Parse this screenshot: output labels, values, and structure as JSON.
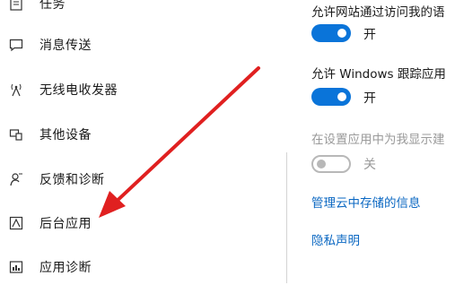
{
  "sidebar": {
    "items": [
      {
        "icon": "task-icon",
        "label": "任务"
      },
      {
        "icon": "chat-bubble-icon",
        "label": "消息传送"
      },
      {
        "icon": "radio-antenna-icon",
        "label": "无线电收发器"
      },
      {
        "icon": "devices-icon",
        "label": "其他设备"
      },
      {
        "icon": "feedback-icon",
        "label": "反馈和诊断"
      },
      {
        "icon": "background-apps-icon",
        "label": "后台应用"
      },
      {
        "icon": "app-diagnostics-icon",
        "label": "应用诊断"
      }
    ]
  },
  "settings": {
    "website_access": {
      "title": "允许网站通过访问我的语",
      "toggle_label": "开",
      "state": "on"
    },
    "windows_tracking": {
      "title": "允许 Windows 跟踪应用",
      "toggle_label": "开",
      "state": "on"
    },
    "settings_app_suggestions": {
      "title": "在设置应用中为我显示建",
      "toggle_label": "关",
      "state": "off-disabled"
    },
    "cloud_link": "管理云中存储的信息",
    "privacy_link": "隐私声明"
  },
  "colors": {
    "accent": "#0a74d9",
    "link": "#0a67c2",
    "arrow": "#e02020",
    "disabled": "#9a9a9a"
  }
}
